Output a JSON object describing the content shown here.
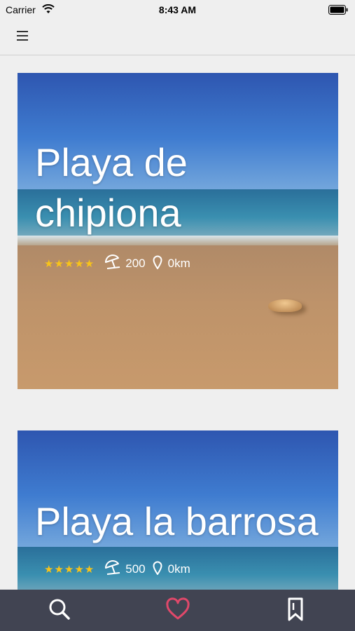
{
  "status_bar": {
    "carrier": "Carrier",
    "time": "8:43 AM"
  },
  "header": {
    "menu_icon": "hamburger-menu-icon"
  },
  "beaches": [
    {
      "name": "Playa de chipiona",
      "rating_stars": 5,
      "stars_text": "★★★★★",
      "capacity": "200",
      "distance": "0km"
    },
    {
      "name": "Playa la barrosa",
      "rating_stars": 5,
      "stars_text": "★★★★★",
      "capacity": "500",
      "distance": "0km"
    }
  ],
  "tab_bar": {
    "tabs": [
      {
        "name": "search",
        "icon": "search-icon",
        "active": false
      },
      {
        "name": "favorites",
        "icon": "heart-icon",
        "active": true
      },
      {
        "name": "saved",
        "icon": "bookmark-icon",
        "active": false
      }
    ]
  },
  "colors": {
    "background": "#efefef",
    "tab_bar": "#414452",
    "active_tab": "#e0486a",
    "star": "#f7c31a"
  }
}
